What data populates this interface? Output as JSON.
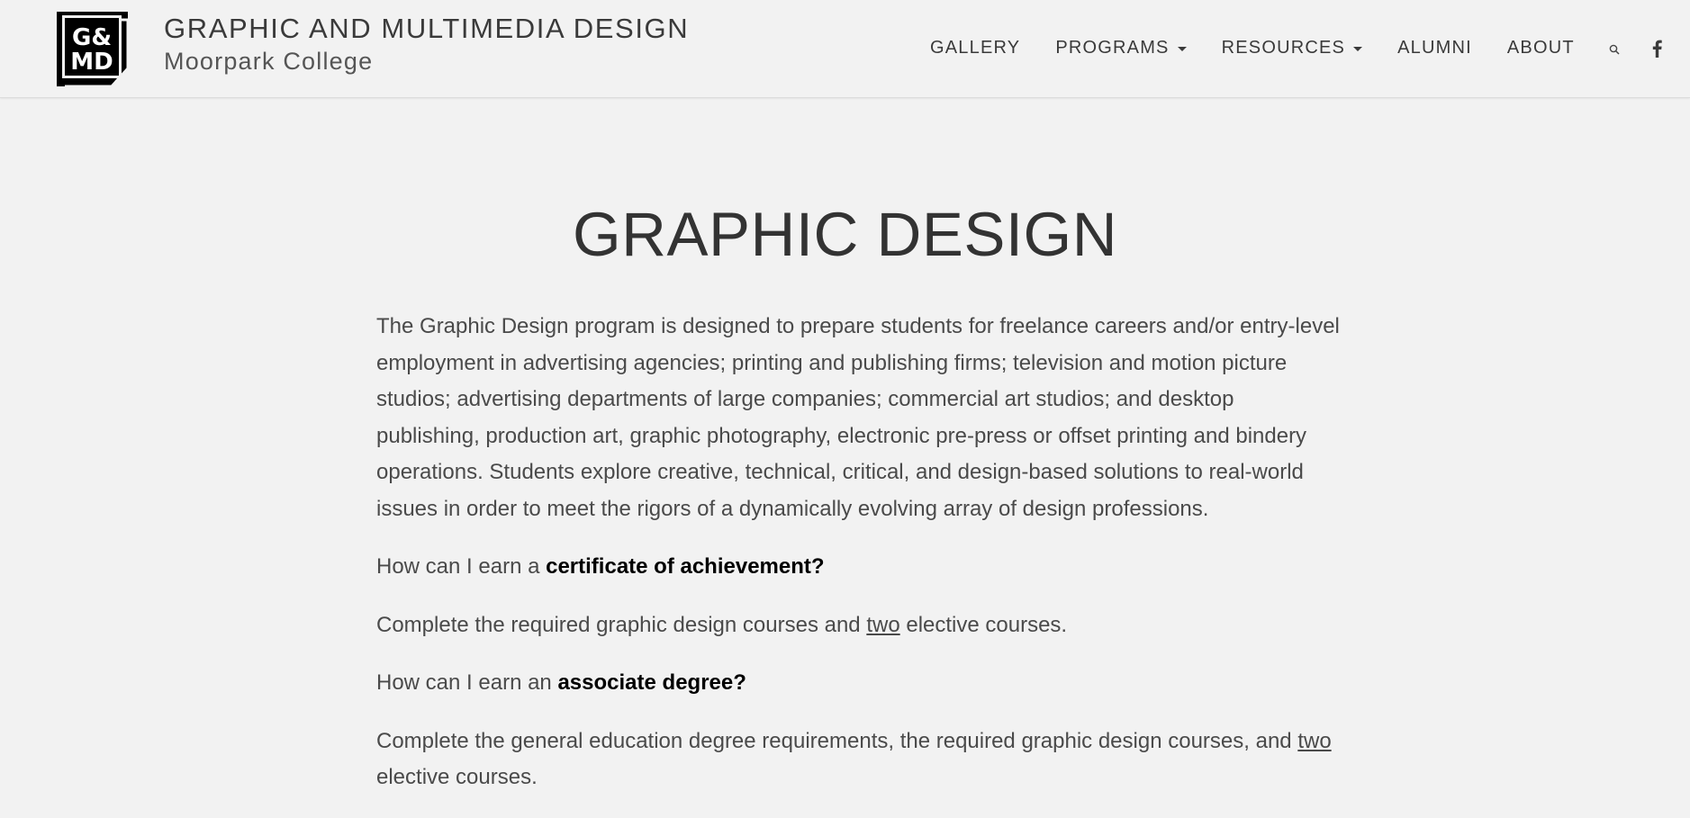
{
  "header": {
    "logo_text_top": "G&",
    "logo_text_bottom": "MD",
    "site_title": "GRAPHIC AND MULTIMEDIA DESIGN",
    "site_subtitle": "Moorpark College"
  },
  "nav": {
    "items": [
      {
        "label": "GALLERY"
      },
      {
        "label": "PROGRAMS"
      },
      {
        "label": "RESOURCES"
      },
      {
        "label": "ALUMNI"
      },
      {
        "label": "ABOUT"
      }
    ],
    "search_icon": "search-icon",
    "facebook_icon": "facebook-icon"
  },
  "page": {
    "title": "GRAPHIC DESIGN",
    "intro": "The Graphic Design program is designed to prepare students for freelance careers and/or entry-level employment in advertising agencies; printing and publishing firms; television and motion picture studios; advertising departments of large companies; commercial art studios; and desktop publishing, production art, graphic photography, electronic pre-press or offset printing and bindery operations. Students explore creative, technical, critical, and design-based solutions to real-world issues in order to meet the rigors of a dynamically evolving array of design professions.",
    "q1_prefix": "How can I earn a ",
    "q1_bold": "certificate of achievement?",
    "a1_prefix": "Complete the required graphic design courses and ",
    "a1_underline": "two",
    "a1_suffix": " elective courses.",
    "q2_prefix": "How can I earn an ",
    "q2_bold": "associate degree?",
    "a2_prefix": "Complete the general education degree requirements, the required graphic design courses, and ",
    "a2_underline": "two",
    "a2_suffix": " elective courses."
  },
  "colors": {
    "background": "#f2f2f2",
    "text": "#4a4a4a",
    "heading": "#333333"
  }
}
